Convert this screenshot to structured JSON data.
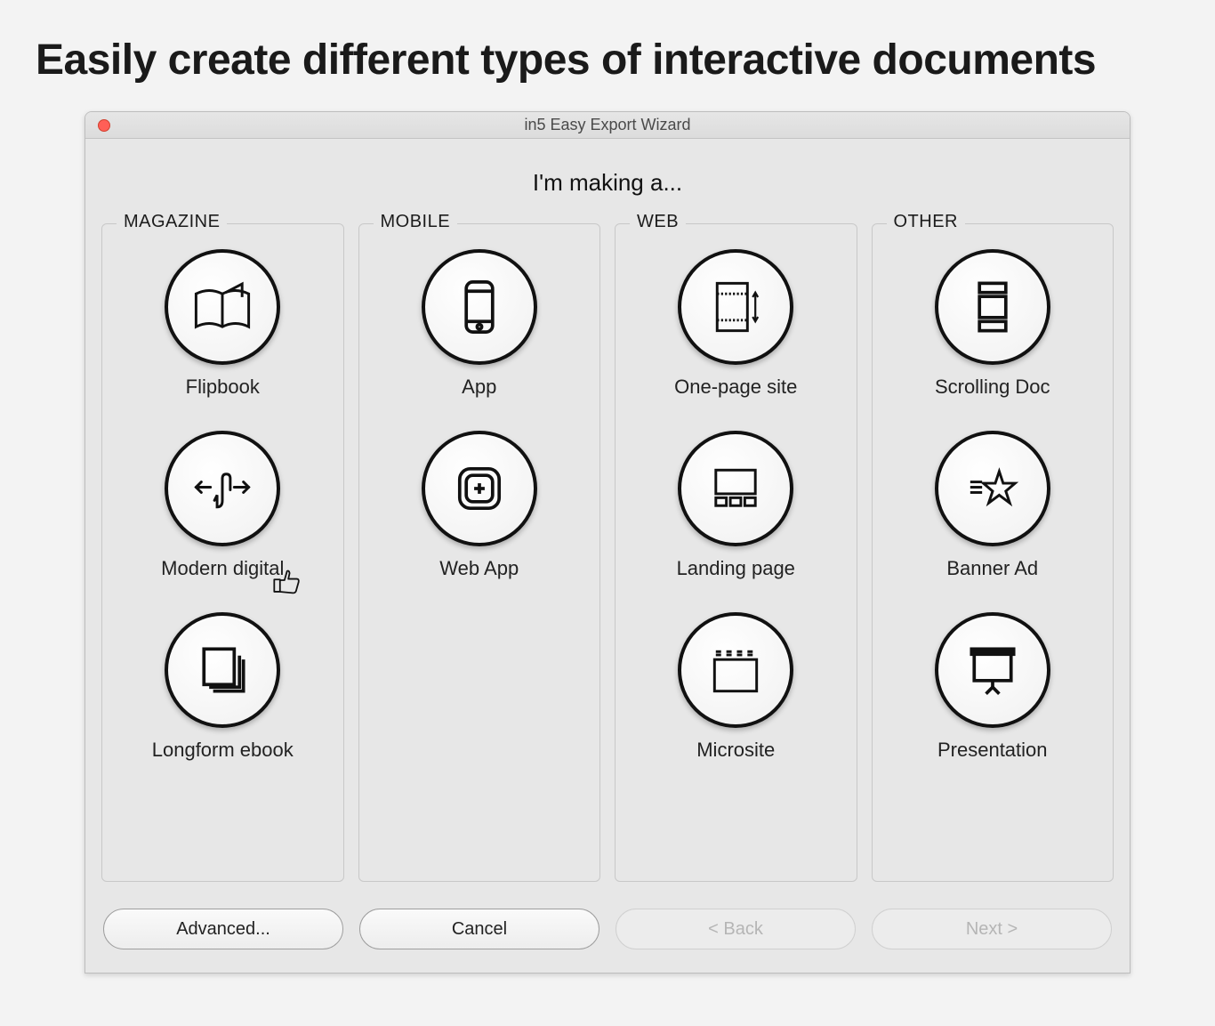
{
  "heading": "Easily create different types of interactive documents",
  "window": {
    "title": "in5 Easy Export Wizard",
    "prompt": "I'm making a..."
  },
  "groups": [
    {
      "title": "MAGAZINE",
      "options": [
        "Flipbook",
        "Modern digital",
        "Longform ebook"
      ]
    },
    {
      "title": "MOBILE",
      "options": [
        "App",
        "Web App"
      ]
    },
    {
      "title": "WEB",
      "options": [
        "One-page site",
        "Landing page",
        "Microsite"
      ]
    },
    {
      "title": "OTHER",
      "options": [
        "Scrolling Doc",
        "Banner Ad",
        "Presentation"
      ]
    }
  ],
  "buttons": {
    "advanced": "Advanced...",
    "cancel": "Cancel",
    "back": "< Back",
    "next": "Next >"
  }
}
